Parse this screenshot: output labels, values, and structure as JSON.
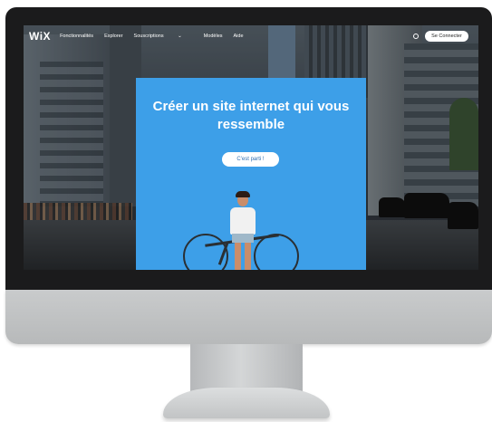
{
  "site": {
    "logo": "WiX",
    "nav": [
      "Fonctionnalités",
      "Explorer",
      "Souscriptions",
      "Modèles",
      "Aide"
    ],
    "login_label": "Se Connecter"
  },
  "hero": {
    "title_line1": "Créer un site internet qui vous",
    "title_line2": "ressemble",
    "cta_label": "C'est parti !"
  },
  "icons": {
    "dropdown": "chevron-down-icon",
    "language": "globe-icon"
  },
  "colors": {
    "hero_bg": "#3d9fe8",
    "cta_text": "#2f6fb2"
  }
}
